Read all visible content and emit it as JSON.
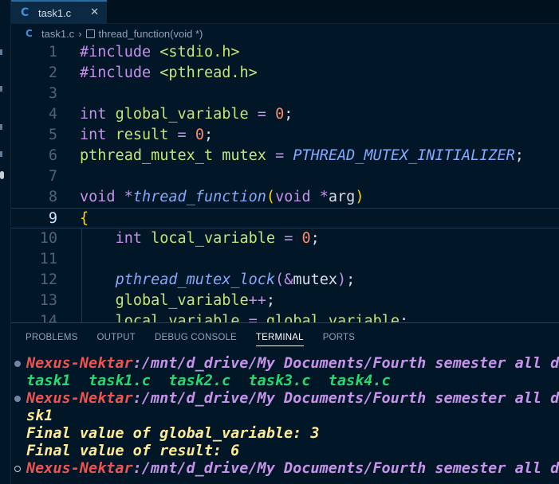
{
  "tab": {
    "icon": "C",
    "label": "task1.c",
    "close": "✕"
  },
  "breadcrumb": {
    "icon": "C",
    "file": "task1.c",
    "separator": "›",
    "symbol": "thread_function(void *)"
  },
  "editor": {
    "current_line": 9,
    "lines": [
      {
        "n": "1",
        "tokens": [
          [
            "kw",
            "#include"
          ],
          [
            "plain",
            " "
          ],
          [
            "str",
            "<stdio.h>"
          ]
        ]
      },
      {
        "n": "2",
        "tokens": [
          [
            "kw",
            "#include"
          ],
          [
            "plain",
            " "
          ],
          [
            "str",
            "<pthread.h>"
          ]
        ]
      },
      {
        "n": "3",
        "tokens": []
      },
      {
        "n": "4",
        "tokens": [
          [
            "kw",
            "int"
          ],
          [
            "plain",
            " "
          ],
          [
            "ident",
            "global_variable"
          ],
          [
            "plain",
            " "
          ],
          [
            "op",
            "="
          ],
          [
            "plain",
            " "
          ],
          [
            "num",
            "0"
          ],
          [
            "punc",
            ";"
          ]
        ]
      },
      {
        "n": "5",
        "tokens": [
          [
            "kw",
            "int"
          ],
          [
            "plain",
            " "
          ],
          [
            "ident",
            "result"
          ],
          [
            "plain",
            " "
          ],
          [
            "op",
            "="
          ],
          [
            "plain",
            " "
          ],
          [
            "num",
            "0"
          ],
          [
            "punc",
            ";"
          ]
        ]
      },
      {
        "n": "6",
        "tokens": [
          [
            "ident",
            "pthread_mutex_t"
          ],
          [
            "plain",
            " "
          ],
          [
            "ident",
            "mutex"
          ],
          [
            "plain",
            " "
          ],
          [
            "op",
            "="
          ],
          [
            "plain",
            " "
          ],
          [
            "macro",
            "PTHREAD_MUTEX_INITIALIZER"
          ],
          [
            "punc",
            ";"
          ]
        ]
      },
      {
        "n": "7",
        "tokens": []
      },
      {
        "n": "8",
        "tokens": [
          [
            "kw",
            "void"
          ],
          [
            "plain",
            " "
          ],
          [
            "op",
            "*"
          ],
          [
            "fn",
            "thread_function"
          ],
          [
            "brace",
            "("
          ],
          [
            "kw",
            "void"
          ],
          [
            "plain",
            " "
          ],
          [
            "op",
            "*"
          ],
          [
            "plain",
            "arg"
          ],
          [
            "brace",
            ")"
          ]
        ]
      },
      {
        "n": "9",
        "tokens": [
          [
            "brace",
            "{"
          ]
        ]
      },
      {
        "n": "10",
        "tokens": [
          [
            "plain",
            "    "
          ],
          [
            "kw",
            "int"
          ],
          [
            "plain",
            " "
          ],
          [
            "ident",
            "local_variable"
          ],
          [
            "plain",
            " "
          ],
          [
            "op",
            "="
          ],
          [
            "plain",
            " "
          ],
          [
            "num",
            "0"
          ],
          [
            "punc",
            ";"
          ]
        ]
      },
      {
        "n": "11",
        "tokens": []
      },
      {
        "n": "12",
        "tokens": [
          [
            "plain",
            "    "
          ],
          [
            "fn",
            "pthread_mutex_lock"
          ],
          [
            "kw",
            "("
          ],
          [
            "op",
            "&"
          ],
          [
            "plain",
            "mutex"
          ],
          [
            "kw",
            ")"
          ],
          [
            "punc",
            ";"
          ]
        ]
      },
      {
        "n": "13",
        "tokens": [
          [
            "plain",
            "    "
          ],
          [
            "ident",
            "global_variable"
          ],
          [
            "op",
            "++"
          ],
          [
            "punc",
            ";"
          ]
        ]
      },
      {
        "n": "14",
        "tokens": [
          [
            "plain",
            "    "
          ],
          [
            "ident",
            "local_variable"
          ],
          [
            "plain",
            " "
          ],
          [
            "op",
            "="
          ],
          [
            "plain",
            " "
          ],
          [
            "ident",
            "global_variable"
          ],
          [
            "punc",
            ";"
          ]
        ]
      }
    ]
  },
  "panel": {
    "tabs": [
      "PROBLEMS",
      "OUTPUT",
      "DEBUG CONSOLE",
      "TERMINAL",
      "PORTS"
    ],
    "active_tab": "TERMINAL"
  },
  "terminal": {
    "lines": [
      {
        "dot": "filled",
        "segments": [
          [
            "user",
            "Nexus-Nektar"
          ],
          [
            "path",
            ":/mnt/d_drive/My Documents/Fourth semester all do"
          ]
        ]
      },
      {
        "dot": "",
        "segments": [
          [
            "file",
            "task1  task1.c  task2.c  task3.c  task4.c"
          ]
        ]
      },
      {
        "dot": "filled",
        "segments": [
          [
            "user",
            "Nexus-Nektar"
          ],
          [
            "path",
            ":/mnt/d_drive/My Documents/Fourth semester all do"
          ]
        ]
      },
      {
        "dot": "",
        "segments": [
          [
            "out",
            "sk1"
          ]
        ]
      },
      {
        "dot": "",
        "segments": [
          [
            "out",
            "Final value of global_variable: 3"
          ]
        ]
      },
      {
        "dot": "",
        "segments": [
          [
            "out",
            "Final value of result: 6"
          ]
        ]
      },
      {
        "dot": "hollow",
        "segments": [
          [
            "user",
            "Nexus-Nektar"
          ],
          [
            "path",
            ":/mnt/d_drive/My Documents/Fourth semester all do"
          ]
        ]
      }
    ]
  }
}
